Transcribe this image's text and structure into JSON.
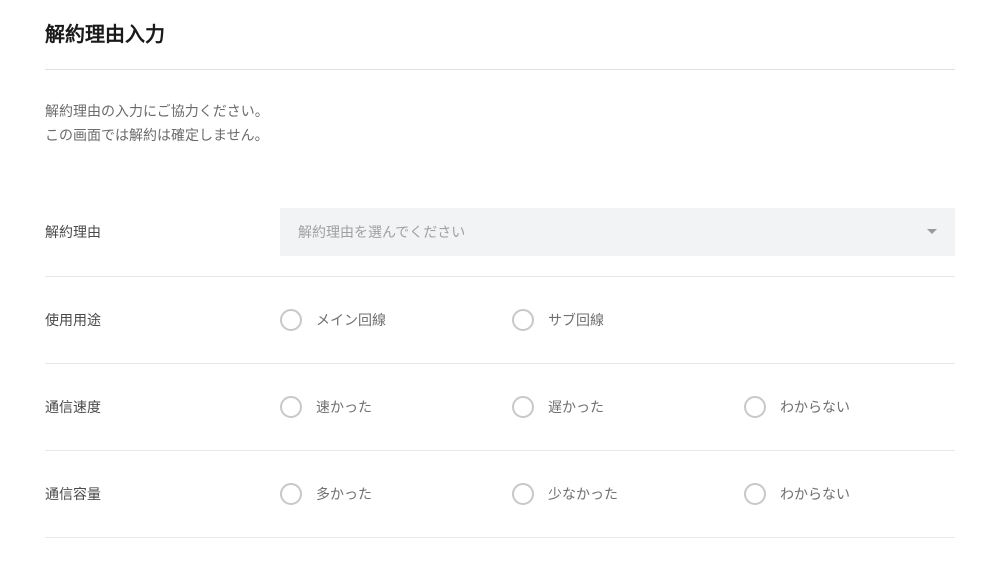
{
  "title": "解約理由入力",
  "description": {
    "line1": "解約理由の入力にご協力ください。",
    "line2": "この画面では解約は確定しません。"
  },
  "reason_select": {
    "label": "解約理由",
    "placeholder": "解約理由を選んでください"
  },
  "usage": {
    "label": "使用用途",
    "options": {
      "main": "メイン回線",
      "sub": "サブ回線"
    }
  },
  "speed": {
    "label": "通信速度",
    "options": {
      "fast": "速かった",
      "slow": "遅かった",
      "unknown": "わからない"
    }
  },
  "capacity": {
    "label": "通信容量",
    "options": {
      "much": "多かった",
      "little": "少なかった",
      "unknown": "わからない"
    }
  }
}
